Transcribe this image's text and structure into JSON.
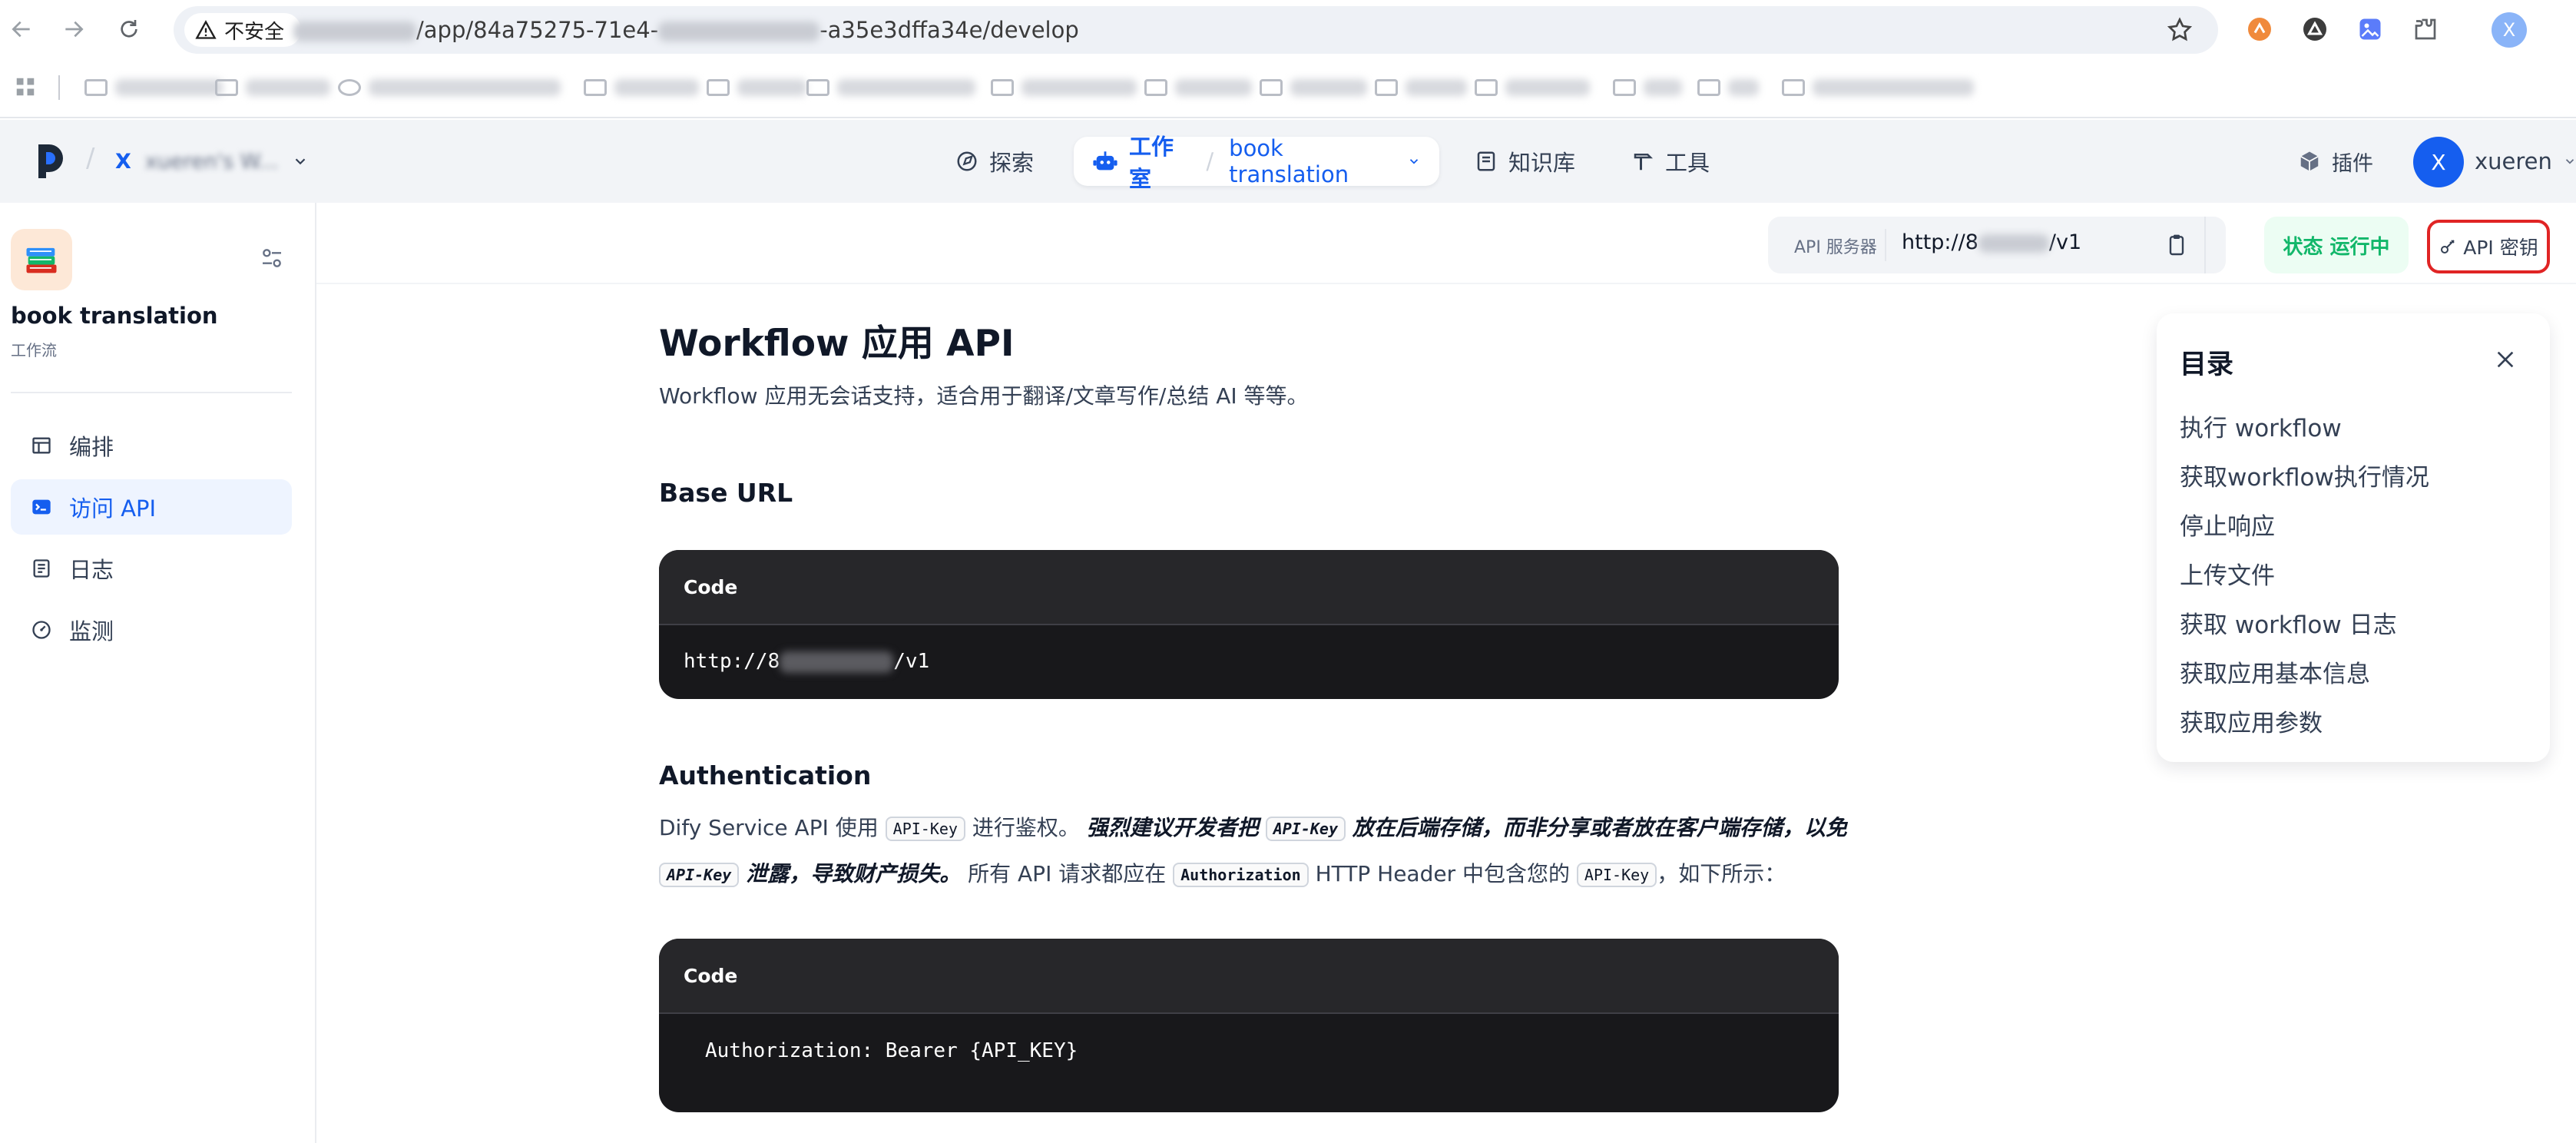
{
  "browser": {
    "insecure_label": "不安全",
    "url_mid": "/app/84a75275-71e4-",
    "url_end": "-a35e3dffa34e/develop",
    "profile_initial": "X"
  },
  "header": {
    "workspace_initial": "X",
    "workspace_name": "xueren's W...",
    "explore": "探索",
    "studio": "工作室",
    "separator": "/",
    "app_name": "book translation",
    "knowledge": "知识库",
    "tools": "工具",
    "plugins": "插件",
    "avatar_initial": "X",
    "user_name": "xueren"
  },
  "sidebar": {
    "app_name": "book translation",
    "app_type": "工作流",
    "items": [
      {
        "label": "编排"
      },
      {
        "label": "访问 API"
      },
      {
        "label": "日志"
      },
      {
        "label": "监测"
      }
    ]
  },
  "toolbar": {
    "api_server_label": "API 服务器",
    "api_server_value_start": "http://8",
    "api_server_value_end": "/v1",
    "status_label": "状态",
    "status_value": "运行中",
    "api_key_button": "API 密钥"
  },
  "doc": {
    "title": "Workflow 应用 API",
    "subtitle": "Workflow 应用无会话支持，适合用于翻译/文章写作/总结 AI 等等。",
    "base_url_heading": "Base URL",
    "code_label": "Code",
    "base_url_start": "http://8",
    "base_url_end": "/v1",
    "auth_heading": "Authentication",
    "auth_p1": "Dify Service API 使用",
    "auth_code_apikey": "API-Key",
    "auth_p2": "进行鉴权。",
    "auth_strong1": "强烈建议开发者把",
    "auth_strong2": "放在后端存储，而非分享或者放在客户端存储，以免",
    "auth_strong3": "泄露，导致财产损失。",
    "auth_p3": "所有 API 请求都应在",
    "auth_code_authorization": "Authorization",
    "auth_p4": "HTTP Header 中包含您的",
    "auth_p5": "，如下所示：",
    "auth_code_line": "Authorization: Bearer {API_KEY}"
  },
  "toc": {
    "title": "目录",
    "items": [
      "执行 workflow",
      "获取workflow执行情况",
      "停止响应",
      "上传文件",
      "获取 workflow 日志",
      "获取应用基本信息",
      "获取应用参数"
    ]
  }
}
